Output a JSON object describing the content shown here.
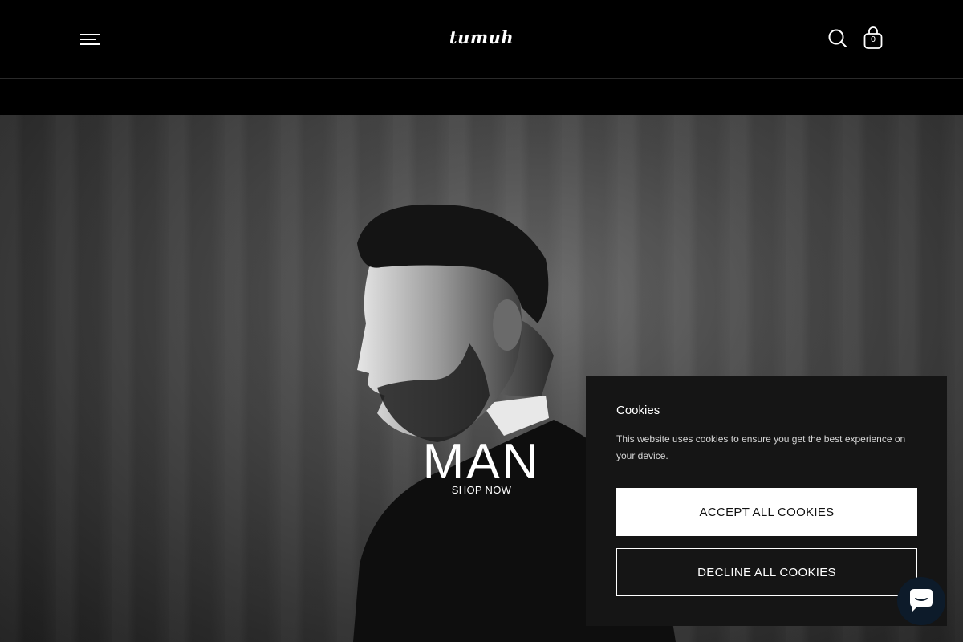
{
  "header": {
    "logo": "tumuh",
    "cart_count": "0",
    "icons": {
      "menu": "hamburger-menu-icon",
      "search": "search-icon",
      "cart": "shopping-bag-icon"
    }
  },
  "hero": {
    "title": "MAN",
    "cta_label": "SHOP NOW"
  },
  "cookie_banner": {
    "title": "Cookies",
    "text": "This website uses cookies to ensure you get the best experience on your device.",
    "accept_label": "ACCEPT ALL COOKIES",
    "decline_label": "DECLINE ALL COOKIES"
  },
  "chat": {
    "icon": "chat-bubble-icon"
  },
  "colors": {
    "header_bg": "#000000",
    "cookie_bg": "#151515",
    "chat_bg": "#0d1b2a",
    "text": "#ffffff"
  }
}
